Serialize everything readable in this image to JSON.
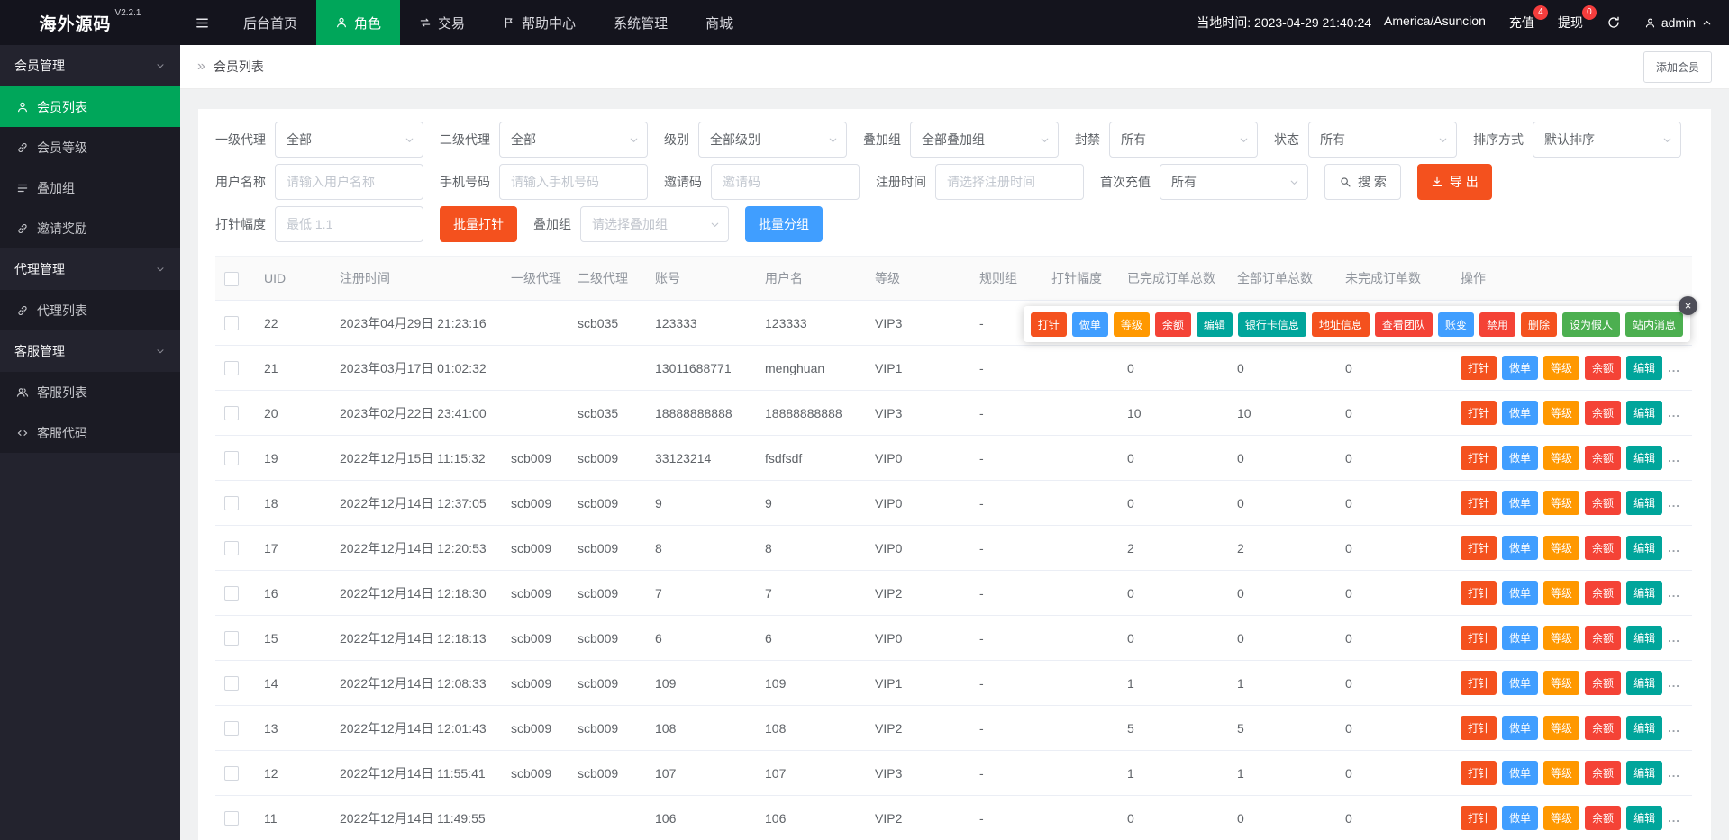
{
  "colors": {
    "accent": "#00a65a",
    "orangered": "#f4511e",
    "red": "#f44336",
    "blue": "#409eff",
    "orange": "#ff9800",
    "teal": "#00a59b",
    "green": "#4caf50"
  },
  "topbar": {
    "logo": "海外源码",
    "version": "V2.2.1",
    "nav": [
      {
        "name": "home",
        "label": "后台首页"
      },
      {
        "name": "roles",
        "label": "角色",
        "icon": "user",
        "active": true
      },
      {
        "name": "trade",
        "label": "交易",
        "icon": "exchange"
      },
      {
        "name": "help",
        "label": "帮助中心",
        "icon": "flag"
      },
      {
        "name": "system",
        "label": "系统管理"
      },
      {
        "name": "mall",
        "label": "商城"
      }
    ],
    "time_label": "当地时间: 2023-04-29 21:40:24",
    "timezone": "America/Asuncion",
    "recharge": {
      "label": "充值",
      "badge": "4"
    },
    "withdraw": {
      "label": "提现",
      "badge": "0"
    },
    "user": "admin"
  },
  "sidebar": {
    "groups": [
      {
        "name": "member",
        "label": "会员管理",
        "items": [
          {
            "name": "member-list",
            "label": "会员列表",
            "icon": "user",
            "active": true
          },
          {
            "name": "member-level",
            "label": "会员等级",
            "icon": "link"
          },
          {
            "name": "overlay-group",
            "label": "叠加组",
            "icon": "list"
          },
          {
            "name": "invite-reward",
            "label": "邀请奖励",
            "icon": "link"
          }
        ]
      },
      {
        "name": "agent",
        "label": "代理管理",
        "items": [
          {
            "name": "agent-list",
            "label": "代理列表",
            "icon": "link"
          }
        ]
      },
      {
        "name": "service",
        "label": "客服管理",
        "items": [
          {
            "name": "service-list",
            "label": "客服列表",
            "icon": "users"
          },
          {
            "name": "service-code",
            "label": "客服代码",
            "icon": "code"
          }
        ]
      }
    ]
  },
  "breadcrumb": {
    "icon": "»",
    "title": "会员列表"
  },
  "add_member_label": "添加会员",
  "filters": {
    "selects": [
      {
        "name": "agent1",
        "label": "一级代理",
        "value": "全部"
      },
      {
        "name": "agent2",
        "label": "二级代理",
        "value": "全部"
      },
      {
        "name": "level",
        "label": "级别",
        "value": "全部级别"
      },
      {
        "name": "overlay-group",
        "label": "叠加组",
        "value": "全部叠加组"
      },
      {
        "name": "ban",
        "label": "封禁",
        "value": "所有"
      },
      {
        "name": "status",
        "label": "状态",
        "value": "所有"
      },
      {
        "name": "sort",
        "label": "排序方式",
        "value": "默认排序"
      }
    ],
    "inputs": [
      {
        "name": "username",
        "label": "用户名称",
        "placeholder": "请输入用户名称"
      },
      {
        "name": "phone",
        "label": "手机号码",
        "placeholder": "请输入手机号码"
      },
      {
        "name": "invite-code",
        "label": "邀请码",
        "placeholder": "邀请码"
      },
      {
        "name": "reg-time",
        "label": "注册时间",
        "placeholder": "请选择注册时间"
      }
    ],
    "first_charge": {
      "label": "首次充值",
      "value": "所有"
    },
    "search_label": "搜 索",
    "export_label": "导 出",
    "inject": {
      "label": "打针幅度",
      "placeholder": "最低 1.1"
    },
    "batch_inject_label": "批量打针",
    "batch_group": {
      "label": "叠加组",
      "placeholder": "请选择叠加组"
    },
    "batch_group_label": "批量分组"
  },
  "table": {
    "headers": [
      "UID",
      "注册时间",
      "一级代理",
      "二级代理",
      "账号",
      "用户名",
      "等级",
      "规则组",
      "打针幅度",
      "已完成订单总数",
      "全部订单总数",
      "未完成订单数",
      "操作"
    ],
    "row_actions": [
      {
        "name": "inject",
        "label": "打针",
        "color": "orangered"
      },
      {
        "name": "order",
        "label": "做单",
        "color": "blue"
      },
      {
        "name": "level",
        "label": "等级",
        "color": "orange"
      },
      {
        "name": "balance",
        "label": "余额",
        "color": "red"
      },
      {
        "name": "edit",
        "label": "编辑",
        "color": "teal"
      }
    ],
    "more_label": "...",
    "rows": [
      {
        "uid": "22",
        "reg_time": "2023年04月29日 21:23:16",
        "agent1": "",
        "agent2": "scb035",
        "account": "123333",
        "username": "123333",
        "level": "VIP3",
        "rule_group": "-",
        "inject": "",
        "done": "",
        "total": "",
        "undone": "",
        "popover": true
      },
      {
        "uid": "21",
        "reg_time": "2023年03月17日 01:02:32",
        "agent1": "",
        "agent2": "",
        "account": "13011688771",
        "username": "menghuan",
        "level": "VIP1",
        "rule_group": "-",
        "inject": "",
        "done": "0",
        "total": "0",
        "undone": "0"
      },
      {
        "uid": "20",
        "reg_time": "2023年02月22日 23:41:00",
        "agent1": "",
        "agent2": "scb035",
        "account": "18888888888",
        "username": "18888888888",
        "level": "VIP3",
        "rule_group": "-",
        "inject": "",
        "done": "10",
        "total": "10",
        "undone": "0"
      },
      {
        "uid": "19",
        "reg_time": "2022年12月15日 11:15:32",
        "agent1": "scb009",
        "agent2": "scb009",
        "account": "33123214",
        "username": "fsdfsdf",
        "level": "VIP0",
        "rule_group": "-",
        "inject": "",
        "done": "0",
        "total": "0",
        "undone": "0"
      },
      {
        "uid": "18",
        "reg_time": "2022年12月14日 12:37:05",
        "agent1": "scb009",
        "agent2": "scb009",
        "account": "9",
        "username": "9",
        "level": "VIP0",
        "rule_group": "-",
        "inject": "",
        "done": "0",
        "total": "0",
        "undone": "0"
      },
      {
        "uid": "17",
        "reg_time": "2022年12月14日 12:20:53",
        "agent1": "scb009",
        "agent2": "scb009",
        "account": "8",
        "username": "8",
        "level": "VIP0",
        "rule_group": "-",
        "inject": "",
        "done": "2",
        "total": "2",
        "undone": "0"
      },
      {
        "uid": "16",
        "reg_time": "2022年12月14日 12:18:30",
        "agent1": "scb009",
        "agent2": "scb009",
        "account": "7",
        "username": "7",
        "level": "VIP2",
        "rule_group": "-",
        "inject": "",
        "done": "0",
        "total": "0",
        "undone": "0"
      },
      {
        "uid": "15",
        "reg_time": "2022年12月14日 12:18:13",
        "agent1": "scb009",
        "agent2": "scb009",
        "account": "6",
        "username": "6",
        "level": "VIP0",
        "rule_group": "-",
        "inject": "",
        "done": "0",
        "total": "0",
        "undone": "0"
      },
      {
        "uid": "14",
        "reg_time": "2022年12月14日 12:08:33",
        "agent1": "scb009",
        "agent2": "scb009",
        "account": "109",
        "username": "109",
        "level": "VIP1",
        "rule_group": "-",
        "inject": "",
        "done": "1",
        "total": "1",
        "undone": "0"
      },
      {
        "uid": "13",
        "reg_time": "2022年12月14日 12:01:43",
        "agent1": "scb009",
        "agent2": "scb009",
        "account": "108",
        "username": "108",
        "level": "VIP2",
        "rule_group": "-",
        "inject": "",
        "done": "5",
        "total": "5",
        "undone": "0"
      },
      {
        "uid": "12",
        "reg_time": "2022年12月14日 11:55:41",
        "agent1": "scb009",
        "agent2": "scb009",
        "account": "107",
        "username": "107",
        "level": "VIP3",
        "rule_group": "-",
        "inject": "",
        "done": "1",
        "total": "1",
        "undone": "0"
      },
      {
        "uid": "11",
        "reg_time": "2022年12月14日 11:49:55",
        "agent1": "",
        "agent2": "",
        "account": "106",
        "username": "106",
        "level": "VIP2",
        "rule_group": "-",
        "inject": "",
        "done": "0",
        "total": "0",
        "undone": "0"
      }
    ]
  },
  "action_popover": {
    "close_label": "×",
    "buttons": [
      {
        "name": "inject",
        "label": "打针",
        "color": "orangered"
      },
      {
        "name": "order",
        "label": "做单",
        "color": "blue"
      },
      {
        "name": "level",
        "label": "等级",
        "color": "orange"
      },
      {
        "name": "balance",
        "label": "余额",
        "color": "red"
      },
      {
        "name": "edit",
        "label": "编辑",
        "color": "teal"
      },
      {
        "name": "bank-card",
        "label": "银行卡信息",
        "color": "teal"
      },
      {
        "name": "address",
        "label": "地址信息",
        "color": "orangered"
      },
      {
        "name": "team",
        "label": "查看团队",
        "color": "red"
      },
      {
        "name": "account-change",
        "label": "账变",
        "color": "blue"
      },
      {
        "name": "disable",
        "label": "禁用",
        "color": "red"
      },
      {
        "name": "delete",
        "label": "删除",
        "color": "orangered"
      },
      {
        "name": "fake-user",
        "label": "设为假人",
        "color": "green"
      },
      {
        "name": "message",
        "label": "站内消息",
        "color": "green"
      }
    ]
  }
}
